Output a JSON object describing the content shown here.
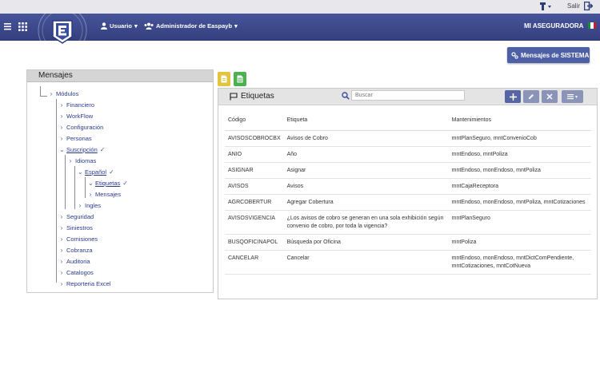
{
  "topbar": {
    "salir_label": "Salir"
  },
  "navbar": {
    "user_label": "Usuario",
    "admin_label": "Administrador de Easpayb",
    "company_label": "MI ASEGURADORA"
  },
  "system_button": {
    "label": "Mensajes de SISTEMA"
  },
  "tree": {
    "header": "Mensajes",
    "root": "Módulos",
    "items": [
      {
        "label": "Financiero"
      },
      {
        "label": "WorkFlow"
      },
      {
        "label": "Configuración"
      },
      {
        "label": "Personas"
      },
      {
        "label": "Suscripción"
      },
      {
        "label": "Idiomas"
      },
      {
        "label": "Español"
      },
      {
        "label": "Etiquetas"
      },
      {
        "label": "Mensajes"
      },
      {
        "label": "Ingles"
      },
      {
        "label": "Seguridad"
      },
      {
        "label": "Siniestros"
      },
      {
        "label": "Comisiones"
      },
      {
        "label": "Cobranza"
      },
      {
        "label": "Auditoria"
      },
      {
        "label": "Catalogos"
      },
      {
        "label": "Reporteria Excel"
      }
    ]
  },
  "panel": {
    "title": "Etiquetas",
    "search_placeholder": "Buscar",
    "columns": [
      "Código",
      "Etiqueta",
      "Mantenimientos"
    ],
    "rows": [
      [
        "AVISOSCOBROCBX",
        "Avisos de Cobro",
        "mntPlanSeguro, mntConvenioCob"
      ],
      [
        "ANIO",
        "Año",
        "mntEndoso, mntPoliza"
      ],
      [
        "ASIGNAR",
        "Asignar",
        "mntEndoso, monEndoso, mntPoliza"
      ],
      [
        "AVISOS",
        "Avisos",
        "mntCajaReceptora"
      ],
      [
        "AGRCOBERTUR",
        "Agregar Cobertura",
        "mntEndoso, monEndoso, mntPoliza, mntCotizaciones"
      ],
      [
        "AVISOSVIGENCIA",
        "¿Los avisos de cobro se generan en una sola exhibición según convenio de cobro, por toda la vigencia?",
        "mntPlanSeguro"
      ],
      [
        "BUSQOFICINAPOL",
        "Búsqueda por Oficina",
        "mntPoliza"
      ],
      [
        "CANCELAR",
        "Cancelar",
        "mntEndoso, monEndoso, mntDictComPendiente, mntCotizaciones, mntCotNueva"
      ]
    ]
  },
  "colors": {
    "navbar": "#3b478a",
    "accent": "#5565a5",
    "tree_link": "#2b3b8a",
    "mini_yellow": "#e3c33f",
    "mini_green": "#4caf50"
  }
}
